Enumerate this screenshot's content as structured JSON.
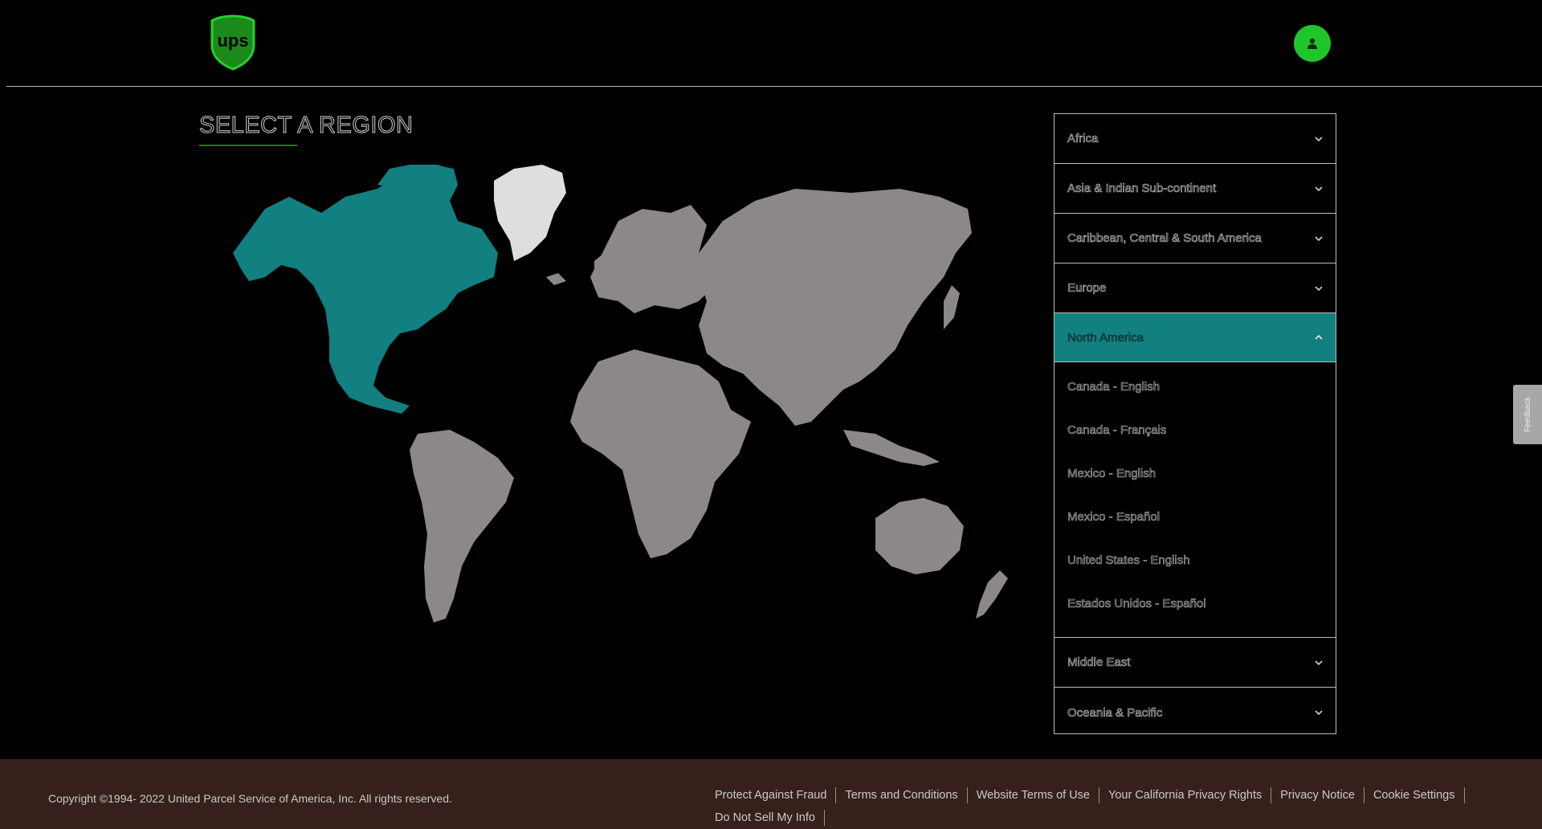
{
  "header": {
    "logo_text": "ups",
    "account_button_label": "My Account"
  },
  "page": {
    "title": "SELECT A REGION"
  },
  "regions": [
    {
      "label": "Africa",
      "expanded": false
    },
    {
      "label": "Asia & Indian Sub-continent",
      "expanded": false
    },
    {
      "label": "Caribbean, Central & South America",
      "expanded": false
    },
    {
      "label": "Europe",
      "expanded": false
    },
    {
      "label": "North America",
      "expanded": true,
      "languages": [
        "Canada - English",
        "Canada - Français",
        "Mexico - English",
        "Mexico - Español",
        "United States - English",
        "Estados Unidos - Español"
      ]
    },
    {
      "label": "Middle East",
      "expanded": false
    },
    {
      "label": "Oceania & Pacific",
      "expanded": false
    }
  ],
  "feedback_tab": {
    "label": "Feedback"
  },
  "footer": {
    "copyright": "Copyright ©1994- 2022  United Parcel Service of America, Inc. All rights reserved.",
    "links": [
      "Protect Against Fraud",
      "Terms and Conditions",
      "Website Terms of Use",
      "Your California Privacy Rights",
      "Privacy Notice",
      "Cookie Settings",
      "Do Not Sell My Info"
    ]
  },
  "colors": {
    "selected_region": "#127f80",
    "map_land": "#8c8888",
    "greenland": "#e0dedc",
    "accent_green": "#1fc62a",
    "footer_bg": "#37201b"
  },
  "icons": {
    "collapsed": "chevron-down-icon",
    "expanded": "chevron-up-icon",
    "account": "user-icon"
  }
}
